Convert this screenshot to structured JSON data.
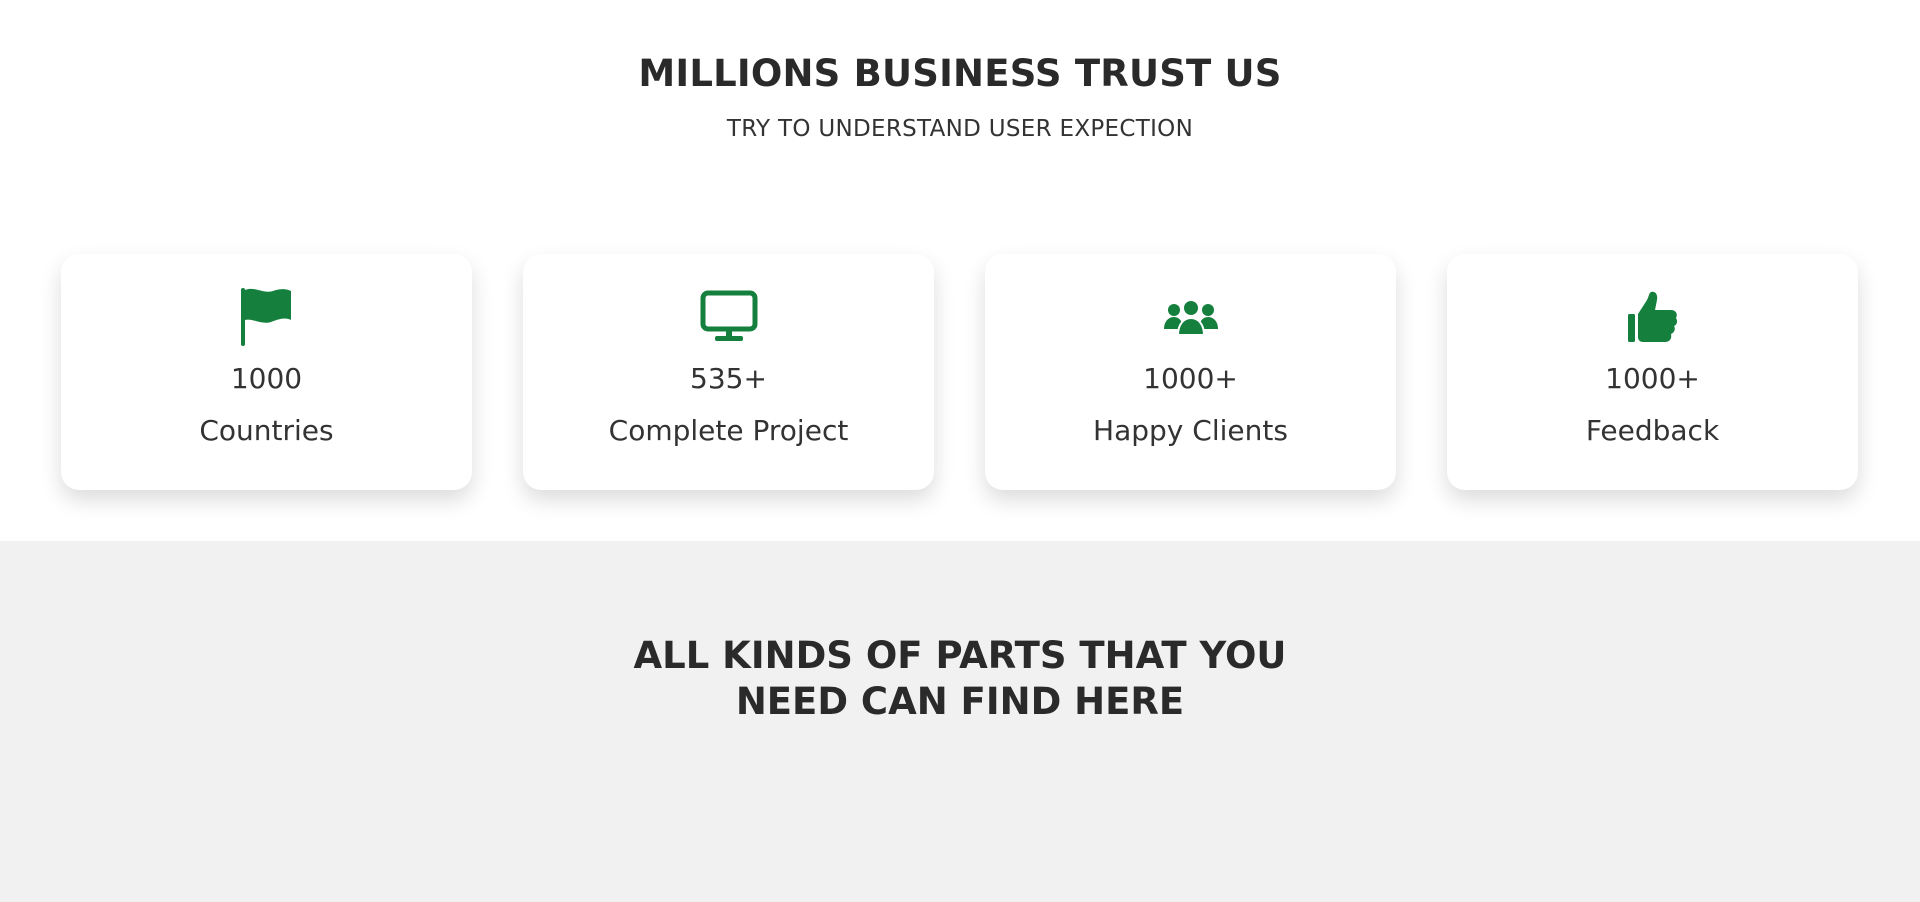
{
  "trust": {
    "title": "MILLIONS BUSINESS TRUST US",
    "subtitle": "TRY TO UNDERSTAND USER EXPECTION"
  },
  "stats": [
    {
      "icon": "flag-icon",
      "value": "1000",
      "label": "Countries"
    },
    {
      "icon": "monitor-icon",
      "value": "535+",
      "label": "Complete Project"
    },
    {
      "icon": "users-icon",
      "value": "1000+",
      "label": "Happy Clients"
    },
    {
      "icon": "thumbs-up-icon",
      "value": "1000+",
      "label": "Feedback"
    }
  ],
  "parts": {
    "title_line_1": "ALL KINDS OF PARTS THAT YOU",
    "title_line_2": "NEED CAN FIND HERE"
  },
  "colors": {
    "accent": "#15803d",
    "text": "#2f2f2f",
    "section_bg": "#f1f1f1"
  }
}
